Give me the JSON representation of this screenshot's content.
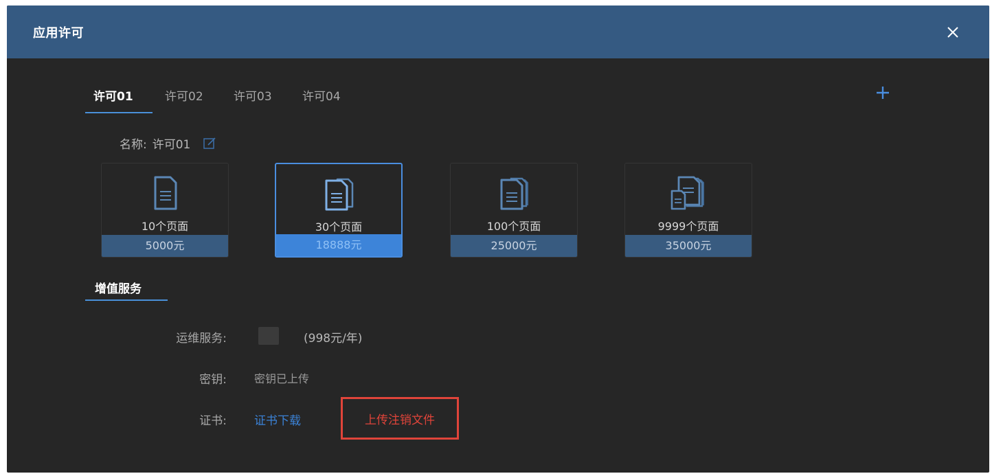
{
  "dialog": {
    "title": "应用许可",
    "header_color": "#355a82",
    "background_color": "#262626"
  },
  "tabs": [
    {
      "label": "许可01",
      "active": true
    },
    {
      "label": "许可02",
      "active": false
    },
    {
      "label": "许可03",
      "active": false
    },
    {
      "label": "许可04",
      "active": false
    }
  ],
  "icons": {
    "close": "close-icon",
    "add": "plus-icon",
    "edit": "edit-icon"
  },
  "name_row": {
    "label": "名称:",
    "value": "许可01"
  },
  "plans": [
    {
      "pages": "10个页面",
      "price": "5000元",
      "icon": "single-document-icon",
      "selected": false
    },
    {
      "pages": "30个页面",
      "price": "18888元",
      "icon": "multi-document-icon",
      "selected": true
    },
    {
      "pages": "100个页面",
      "price": "25000元",
      "icon": "stacked-documents-icon",
      "selected": false
    },
    {
      "pages": "9999个页面",
      "price": "35000元",
      "icon": "many-documents-icon",
      "selected": false
    }
  ],
  "value_added": {
    "section_title": "增值服务",
    "ops_label": "运维服务:",
    "ops_price": "(998元/年)",
    "ops_checked": false,
    "key_label": "密钥:",
    "key_status": "密钥已上传",
    "cert_label": "证书:",
    "cert_download": "证书下载",
    "upload_cancel": "上传注销文件"
  },
  "colors": {
    "accent": "#4a90d9",
    "link": "#3b82d6",
    "danger": "#e0443a",
    "price_bar": "#385b80",
    "price_bar_selected": "#3d84d9"
  }
}
